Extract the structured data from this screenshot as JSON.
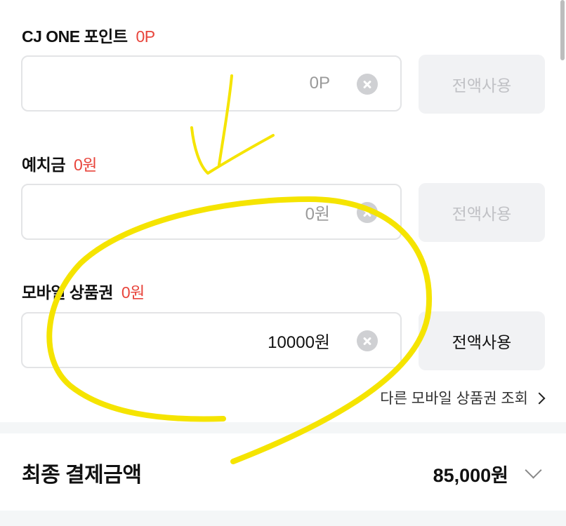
{
  "cj_one": {
    "label": "CJ ONE 포인트",
    "amount": "0P",
    "input_value": "0P",
    "use_all_label": "전액사용"
  },
  "deposit": {
    "label": "예치금",
    "amount": "0원",
    "input_value": "0원",
    "use_all_label": "전액사용"
  },
  "mobile_gift": {
    "label": "모바일 상품권",
    "amount": "0원",
    "input_value": "10000원",
    "use_all_label": "전액사용",
    "other_link": "다른 모바일 상품권 조회"
  },
  "total": {
    "title": "최종 결제금액",
    "amount": "85,000원"
  },
  "colors": {
    "accent_red": "#e8453c",
    "annotation_yellow": "#f5e400",
    "field_border": "#e3e4e6",
    "button_bg": "#f1f2f4"
  },
  "icons": [
    "clear-icon",
    "chevron-right-icon",
    "chevron-down-icon"
  ]
}
